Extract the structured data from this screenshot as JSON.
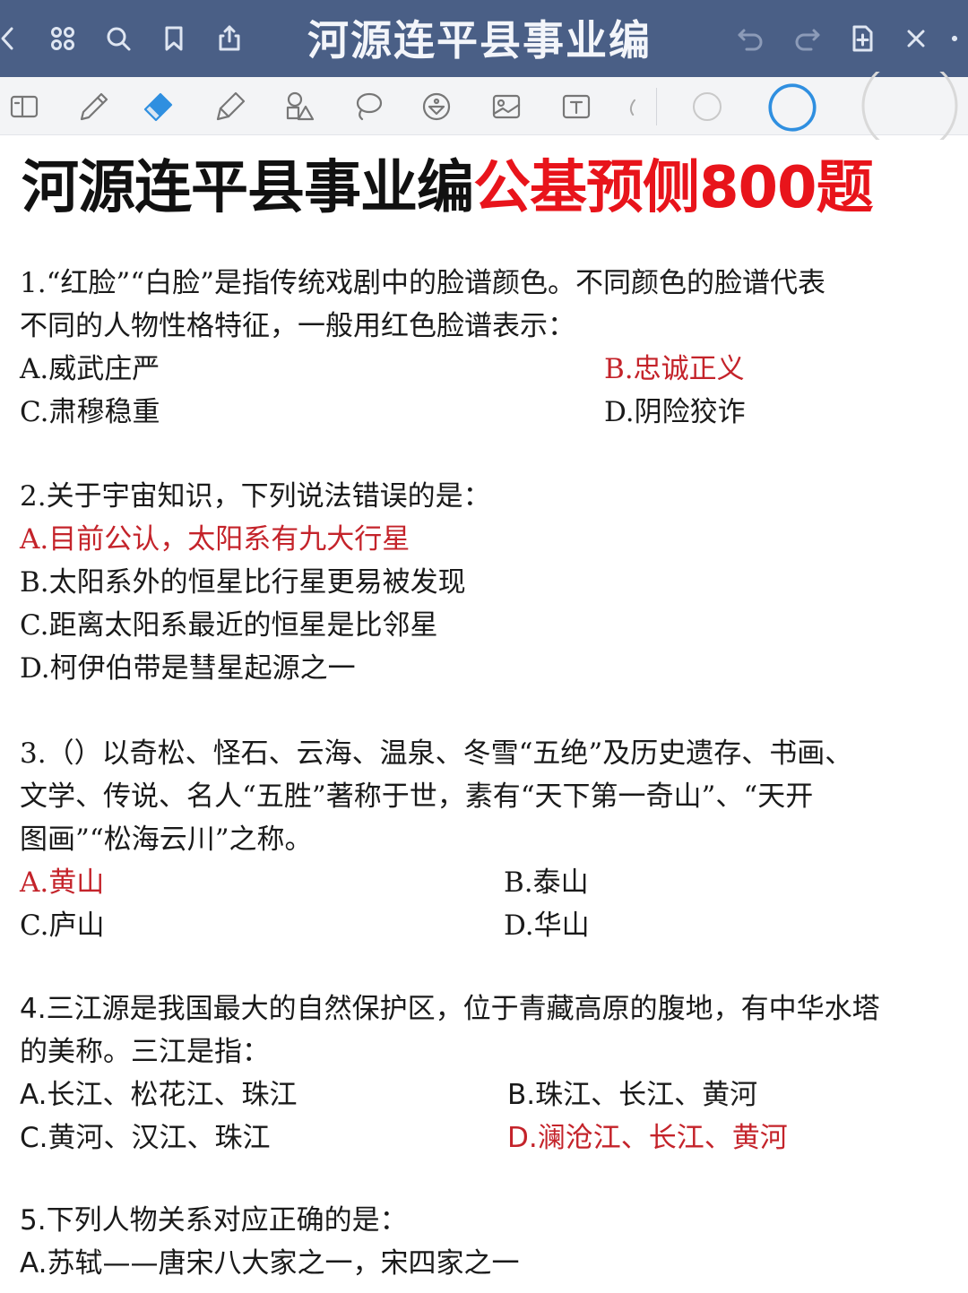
{
  "toolbar": {
    "title": "河源连平县事业编"
  },
  "document": {
    "title_black": "河源连平县事业编",
    "title_red": "公基预侧800题",
    "questions": [
      {
        "stem": [
          "1.“红脸”“白脸”是指传统戏剧中的脸谱颜色。不同颜色的脸谱代表",
          "不同的人物性格特征，一般用红色脸谱表示："
        ],
        "options": [
          "A.威武庄严",
          "B.忠诚正义",
          "C.肃穆稳重",
          "D.阴险狡诈"
        ],
        "answer": "B"
      },
      {
        "stem": [
          "2.关于宇宙知识，下列说法错误的是："
        ],
        "options": [
          "A.目前公认，太阳系有九大行星",
          "B.太阳系外的恒星比行星更易被发现",
          "C.距离太阳系最近的恒星是比邻星",
          "D.柯伊伯带是彗星起源之一"
        ],
        "answer": "A"
      },
      {
        "stem": [
          "3.（）以奇松、怪石、云海、温泉、冬雪“五绝”及历史遗存、书画、",
          "文学、传说、名人“五胜”著称于世，素有“天下第一奇山”、“天开",
          "图画”“松海云川”之称。"
        ],
        "options": [
          "A.黄山",
          "B.泰山",
          "C.庐山",
          "D.华山"
        ],
        "answer": "A"
      },
      {
        "stem": [
          "4.三江源是我国最大的自然保护区，位于青藏高原的腹地，有中华水塔",
          "的美称。三江是指："
        ],
        "options": [
          "A.长江、松花江、珠江",
          "B.珠江、长江、黄河",
          "C.黄河、汉江、珠江",
          "D.澜沧江、长江、黄河"
        ],
        "answer": "D"
      },
      {
        "stem": [
          "5.下列人物关系对应正确的是："
        ],
        "options": [
          "A.苏轼——唐宋八大家之一，宋四家之一"
        ],
        "answer": ""
      }
    ]
  },
  "colors": {
    "toolbar_bg": "#4a5f86",
    "title_red": "#e8141b",
    "answer_red": "#c4232a",
    "active_tool": "#2f8fe0"
  }
}
